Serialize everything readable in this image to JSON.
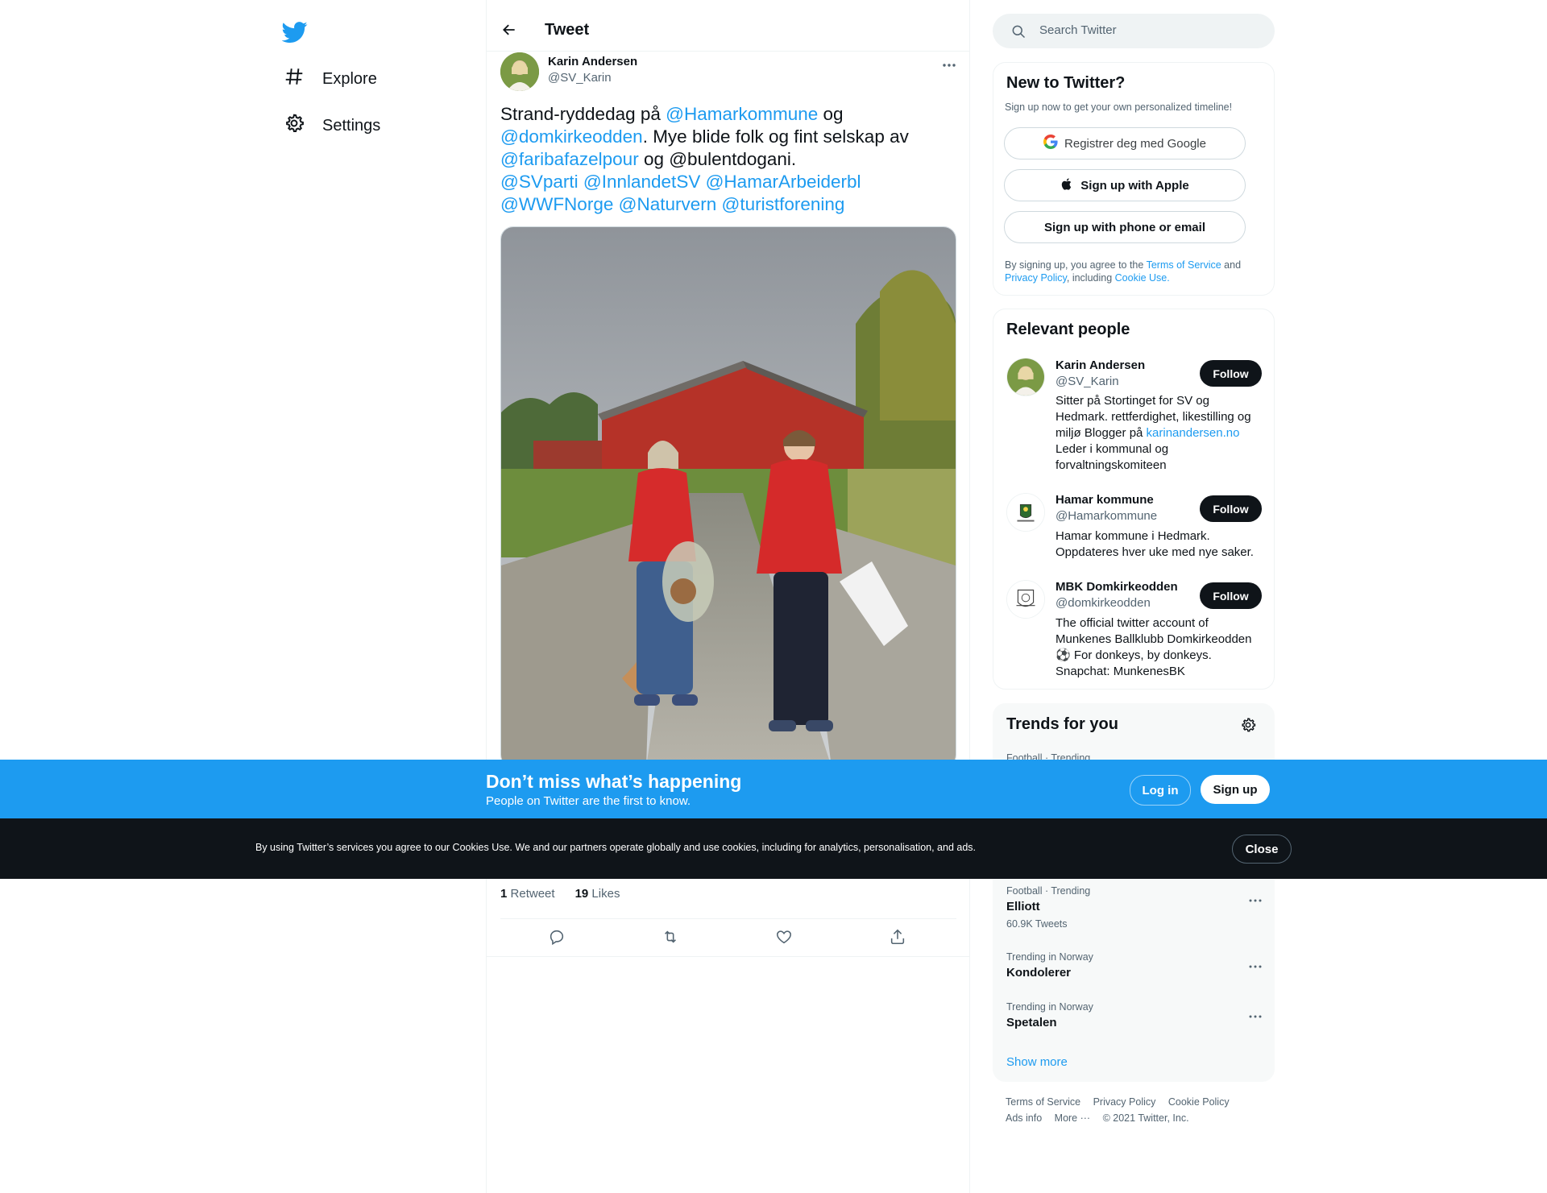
{
  "nav": {
    "logo": "twitter-bird-icon",
    "items": [
      {
        "label": "Explore",
        "icon": "hashtag-icon"
      },
      {
        "label": "Settings",
        "icon": "gear-icon"
      }
    ]
  },
  "header": {
    "title": "Tweet"
  },
  "tweet": {
    "author_name": "Karin Andersen",
    "author_handle": "@SV_Karin",
    "text": {
      "p1": "Strand-ryddedag på ",
      "m1": "@Hamarkommune",
      "p2": " og ",
      "m2": "@domkirkeodden",
      "p3": ". Mye blide folk og fint selskap av ",
      "m3": "@faribafazelpour",
      "p4": " og @bulentdogani. ",
      "m4": "@SVparti",
      "m5": "@InnlandetSV",
      "m6": "@HamarArbeiderbl",
      "m7": "@WWFNorge",
      "m8": "@Naturvern",
      "m9": "@turistforening"
    },
    "retweets_count": "1",
    "retweets_label": "Retweet",
    "likes_count": "19",
    "likes_label": "Likes"
  },
  "search": {
    "placeholder": "Search Twitter"
  },
  "new_to_twitter": {
    "title": "New to Twitter?",
    "subtitle": "Sign up now to get your own personalized timeline!",
    "google_label": "Registrer deg med Google",
    "apple_label": "Sign up with Apple",
    "phone_label": "Sign up with phone or email",
    "note_p1": "By signing up, you agree to the ",
    "note_tos": "Terms of Service",
    "note_p2": " and ",
    "note_privacy": "Privacy Policy",
    "note_p3": ", including ",
    "note_cookie": "Cookie Use."
  },
  "relevant_people": {
    "title": "Relevant people",
    "follow_label": "Follow",
    "people": [
      {
        "name": "Karin Andersen",
        "handle": "@SV_Karin",
        "bio_p1": "Sitter på Stortinget for SV og Hedmark. rettferdighet, likestilling og miljø Blogger på ",
        "bio_link": "karinandersen.no",
        "bio_p2": " Leder i kommunal og forvaltningskomiteen"
      },
      {
        "name": "Hamar kommune",
        "handle": "@Hamarkommune",
        "bio": "Hamar kommune i Hedmark. Oppdateres hver uke med nye saker."
      },
      {
        "name": "MBK Domkirkeodden",
        "handle": "@domkirkeodden",
        "bio_p1": "The official twitter account of Munkenes Ballklubb Domkirkeodden ",
        "bio_p2": " For donkeys, by donkeys. Snapchat: MunkenesBK"
      }
    ]
  },
  "trends": {
    "title": "Trends for you",
    "items": [
      {
        "meta": "Football · Trending",
        "name": "",
        "count": ""
      },
      {
        "meta": "Football · Trending",
        "name": "Elliott",
        "count": "60.9K Tweets"
      },
      {
        "meta": "Trending in Norway",
        "name": "Kondolerer",
        "count": ""
      },
      {
        "meta": "Trending in Norway",
        "name": "Spetalen",
        "count": ""
      }
    ],
    "show_more": "Show more"
  },
  "footer": {
    "links": [
      "Terms of Service",
      "Privacy Policy",
      "Cookie Policy",
      "Ads info",
      "More ···",
      "© 2021 Twitter, Inc."
    ]
  },
  "banner": {
    "title": "Don’t miss what’s happening",
    "subtitle": "People on Twitter are the first to know.",
    "login": "Log in",
    "signup": "Sign up"
  },
  "cookie": {
    "text": "By using Twitter’s services you agree to our Cookies Use. We and our partners operate globally and use cookies, including for analytics, personalisation, and ads.",
    "close": "Close"
  },
  "colors": {
    "accent": "#1d9bf0",
    "text": "#0f1419",
    "muted": "#536471",
    "border": "#eff3f4"
  }
}
